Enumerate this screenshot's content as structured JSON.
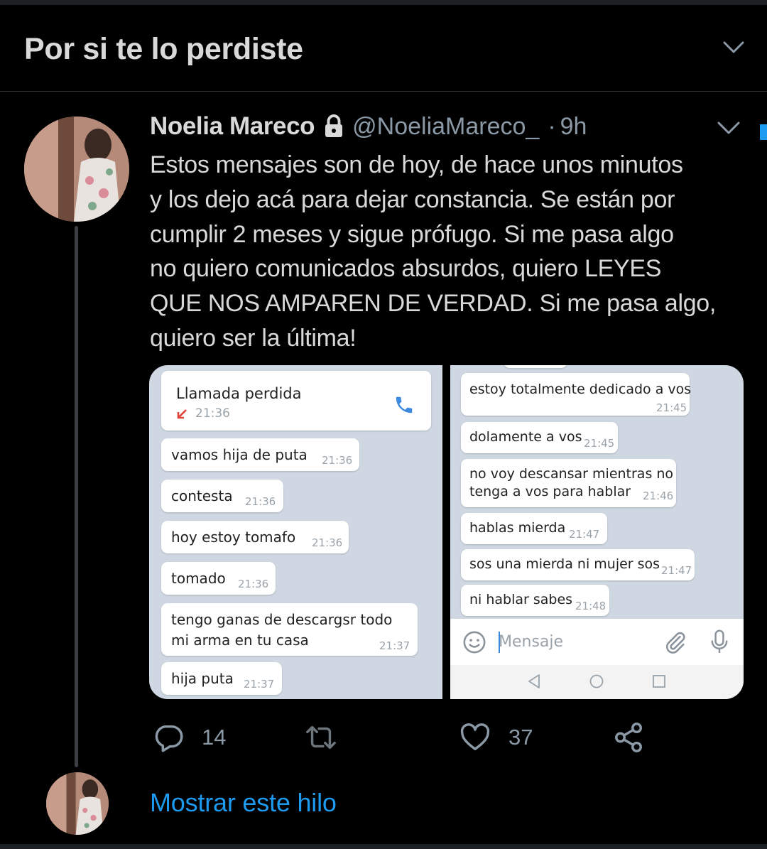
{
  "section": {
    "title": "Por si te lo perdiste"
  },
  "tweet": {
    "author_name": "Noelia Mareco",
    "handle": "@NoeliaMareco_",
    "separator": "·",
    "time": "9h",
    "text_lines": [
      "Estos mensajes son de hoy, de hace unos minutos",
      "y los dejo acá para dejar constancia. Se están por",
      "cumplir 2 meses y sigue prófugo. Si me pasa algo",
      "no quiero comunicados absurdos, quiero LEYES",
      "QUE NOS AMPAREN DE VERDAD. Si me pasa algo,",
      "quiero ser la última!"
    ],
    "stats": {
      "replies": "14",
      "likes": "37"
    },
    "show_thread": "Mostrar este hilo"
  },
  "screenshot_left": {
    "missed_call": {
      "title": "Llamada perdida",
      "time": "21:36"
    },
    "messages": [
      {
        "text": "vamos hija de puta",
        "time": "21:36"
      },
      {
        "text": "contesta",
        "time": "21:36"
      },
      {
        "text": "hoy estoy tomafo",
        "time": "21:36"
      },
      {
        "text": "tomado",
        "time": "21:36"
      },
      {
        "text": "tengo ganas de descargsr todo",
        "text2": "mi arma en tu casa",
        "time": "21:37"
      },
      {
        "text": "hija puta",
        "time": "21:37"
      }
    ]
  },
  "screenshot_right": {
    "messages": [
      {
        "text": "estoy totalmente dedicado a vos",
        "time": "21:45"
      },
      {
        "text": "dolamente a vos",
        "time": "21:45"
      },
      {
        "text": "no voy descansar mientras no",
        "text2": "tenga a vos para hablar",
        "time": "21:46"
      },
      {
        "text": "hablas mierda",
        "time": "21:47"
      },
      {
        "text": "sos una mierda ni mujer sos",
        "time": "21:47"
      },
      {
        "text": "ni hablar sabes",
        "time": "21:48"
      }
    ],
    "input_placeholder": "Mensaje"
  },
  "icons": {
    "header": "chevron-down-icon",
    "protected": "lock-icon",
    "reply": "reply-icon",
    "retweet": "retweet-icon",
    "like": "heart-icon",
    "share": "share-icon"
  },
  "colors": {
    "background": "#000000",
    "accent": "#1d9bf0",
    "text": "#d9d9d9",
    "muted": "#8b98a5"
  }
}
